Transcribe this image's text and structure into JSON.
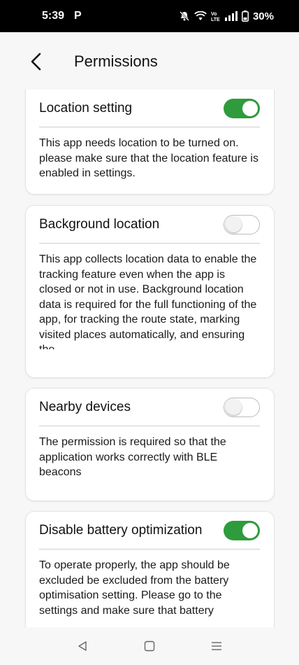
{
  "status_bar": {
    "time": "5:39",
    "notification_letter": "P",
    "battery_percent": "30%",
    "icons": [
      "mute-icon",
      "wifi-icon",
      "volte-icon",
      "signal-icon",
      "battery-icon"
    ]
  },
  "app_bar": {
    "title": "Permissions",
    "back_icon": "back-arrow-icon"
  },
  "permissions": [
    {
      "title": "Location setting",
      "enabled": true,
      "description": "This app needs location to be turned on. please make sure that the location feature is enabled in settings."
    },
    {
      "title": "Background location",
      "enabled": false,
      "description": "This app collects location data to enable the tracking feature even when the app is closed or not in use. Background location data is required for the full functioning of the app, for tracking the route state, marking visited places automatically, and ensuring the…"
    },
    {
      "title": "Nearby devices",
      "enabled": false,
      "description": "The permission is required so that the application works correctly with BLE beacons"
    },
    {
      "title": "Disable battery optimization",
      "enabled": true,
      "description": "To operate properly, the app should be excluded be excluded from the battery optimisation setting. Please go to the settings and make sure that battery"
    }
  ],
  "colors": {
    "toggle_on": "#2e9b3c",
    "background": "#f7f7f7",
    "card": "#ffffff"
  },
  "nav_bar": {
    "icons": [
      "back-triangle-icon",
      "home-square-icon",
      "recents-menu-icon"
    ]
  }
}
